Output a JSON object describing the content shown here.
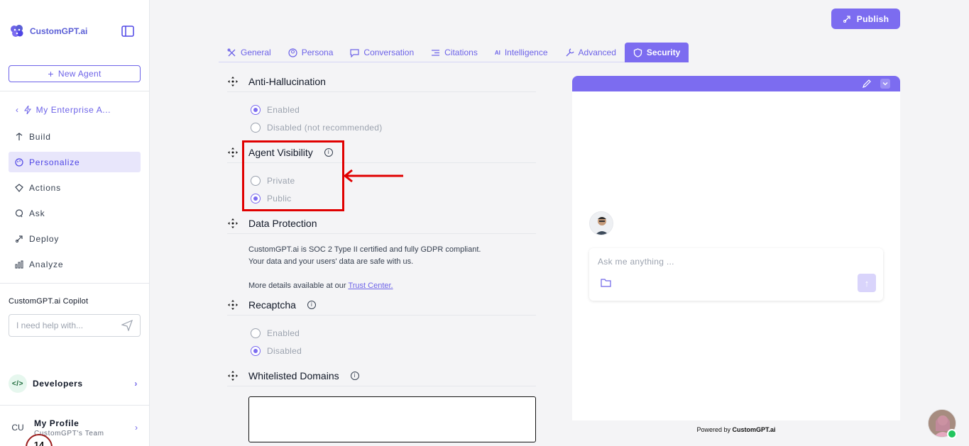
{
  "sidebar": {
    "brand": "CustomGPT.ai",
    "new_agent_label": "New Agent",
    "agent_name": "My Enterprise A...",
    "nav": [
      {
        "label": "Build",
        "icon": "build-icon"
      },
      {
        "label": "Personalize",
        "icon": "palette-icon",
        "active": true
      },
      {
        "label": "Actions",
        "icon": "actions-icon"
      },
      {
        "label": "Ask",
        "icon": "chat-icon"
      },
      {
        "label": "Deploy",
        "icon": "rocket-icon"
      },
      {
        "label": "Analyze",
        "icon": "bar-chart-icon"
      }
    ],
    "copilot_title": "CustomGPT.ai Copilot",
    "copilot_placeholder": "I need help with...",
    "developers_label": "Developers",
    "profile_initials": "CU",
    "profile_name": "My Profile",
    "profile_team": "CustomGPT's Team",
    "notification_count": "14"
  },
  "header": {
    "publish_label": "Publish"
  },
  "tabs": [
    {
      "label": "General",
      "icon": "tools-icon"
    },
    {
      "label": "Persona",
      "icon": "user-circle-icon"
    },
    {
      "label": "Conversation",
      "icon": "message-icon"
    },
    {
      "label": "Citations",
      "icon": "citations-icon"
    },
    {
      "label": "Intelligence",
      "icon": "ai-icon"
    },
    {
      "label": "Advanced",
      "icon": "wrench-icon"
    },
    {
      "label": "Security",
      "icon": "shield-icon",
      "active": true
    }
  ],
  "sections": {
    "anti_hallucination": {
      "title": "Anti-Hallucination",
      "options": [
        "Enabled",
        "Disabled (not recommended)"
      ],
      "selected": "Enabled"
    },
    "agent_visibility": {
      "title": "Agent Visibility",
      "options": [
        "Private",
        "Public"
      ],
      "selected": "Public"
    },
    "data_protection": {
      "title": "Data Protection",
      "line1": "CustomGPT.ai is SOC 2 Type II certified and fully GDPR compliant.",
      "line2": "Your data and your users' data are safe with us.",
      "line3_prefix": "More details available at our",
      "link_text": "Trust Center."
    },
    "recaptcha": {
      "title": "Recaptcha",
      "options": [
        "Enabled",
        "Disabled"
      ],
      "selected": "Disabled"
    },
    "whitelisted_domains": {
      "title": "Whitelisted Domains",
      "value": ""
    }
  },
  "chat": {
    "placeholder": "Ask me anything ...",
    "powered_prefix": "Powered by",
    "powered_brand": "CustomGPT.ai"
  },
  "colors": {
    "accent": "#7c6cf0",
    "highlight": "#e00000"
  }
}
